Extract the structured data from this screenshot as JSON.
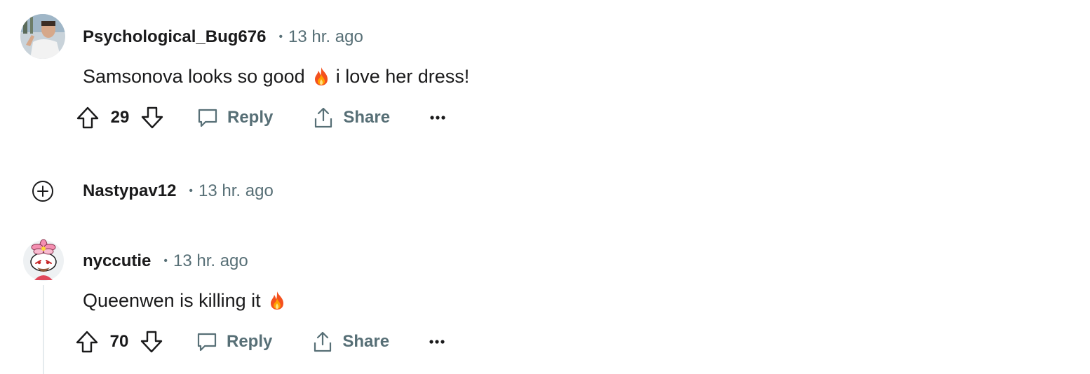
{
  "comments": [
    {
      "username": "Psychological_Bug676",
      "separator": "•",
      "time": "13 hr. ago",
      "text_before": "Samsonova looks so good",
      "text_after": "i love her dress!",
      "score": "29",
      "reply_label": "Reply",
      "share_label": "Share",
      "avatar_icon": "user-photo-avatar"
    },
    {
      "username": "Nastypav12",
      "separator": "•",
      "time": "13 hr. ago",
      "collapsed": true,
      "expand_icon": "plus-circle-icon"
    },
    {
      "username": "nyccutie",
      "separator": "•",
      "time": "13 hr. ago",
      "text_before": "Queenwen is killing it",
      "score": "70",
      "reply_label": "Reply",
      "share_label": "Share",
      "avatar_icon": "snoo-avatar-flower-hat"
    }
  ],
  "colors": {
    "meta_gray": "#576f76",
    "text": "#1a1a1b",
    "thread_line": "#e5ebee"
  }
}
